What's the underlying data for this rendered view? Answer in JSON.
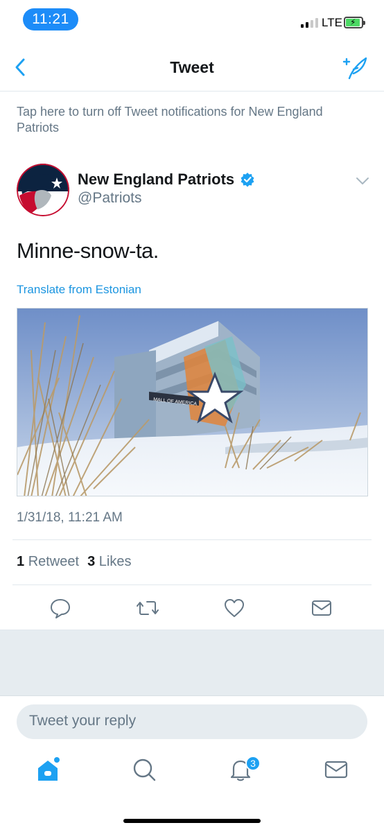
{
  "status_bar": {
    "time": "11:21",
    "network": "LTE",
    "signal_bars": 2,
    "battery_level": 0.9,
    "charging": true
  },
  "nav": {
    "title": "Tweet",
    "back_icon": "chevron-left-icon",
    "compose_icon": "compose-tweet-icon"
  },
  "notification_toggle": "Tap here to turn off Tweet notifications for New England Patriots",
  "tweet": {
    "author_name": "New England Patriots",
    "verified": true,
    "handle": "@Patriots",
    "text": "Minne-snow-ta.",
    "translate_label": "Translate from Estonian",
    "media_sign_text": "MALL OF AMERICA",
    "timestamp": "1/31/18, 11:21 AM",
    "retweets": {
      "count": "1",
      "label": "Retweet"
    },
    "likes": {
      "count": "3",
      "label": "Likes"
    }
  },
  "actions": [
    "reply-icon",
    "retweet-icon",
    "like-icon",
    "share-icon"
  ],
  "reply": {
    "placeholder": "Tweet your reply"
  },
  "tabbar": {
    "items": [
      "home-icon",
      "search-icon",
      "notifications-icon",
      "messages-icon"
    ],
    "notifications_badge": "3"
  },
  "colors": {
    "accent": "#1DA1F2",
    "text": "#14171A",
    "secondary": "#657786",
    "pill": "#1D8CF8"
  }
}
